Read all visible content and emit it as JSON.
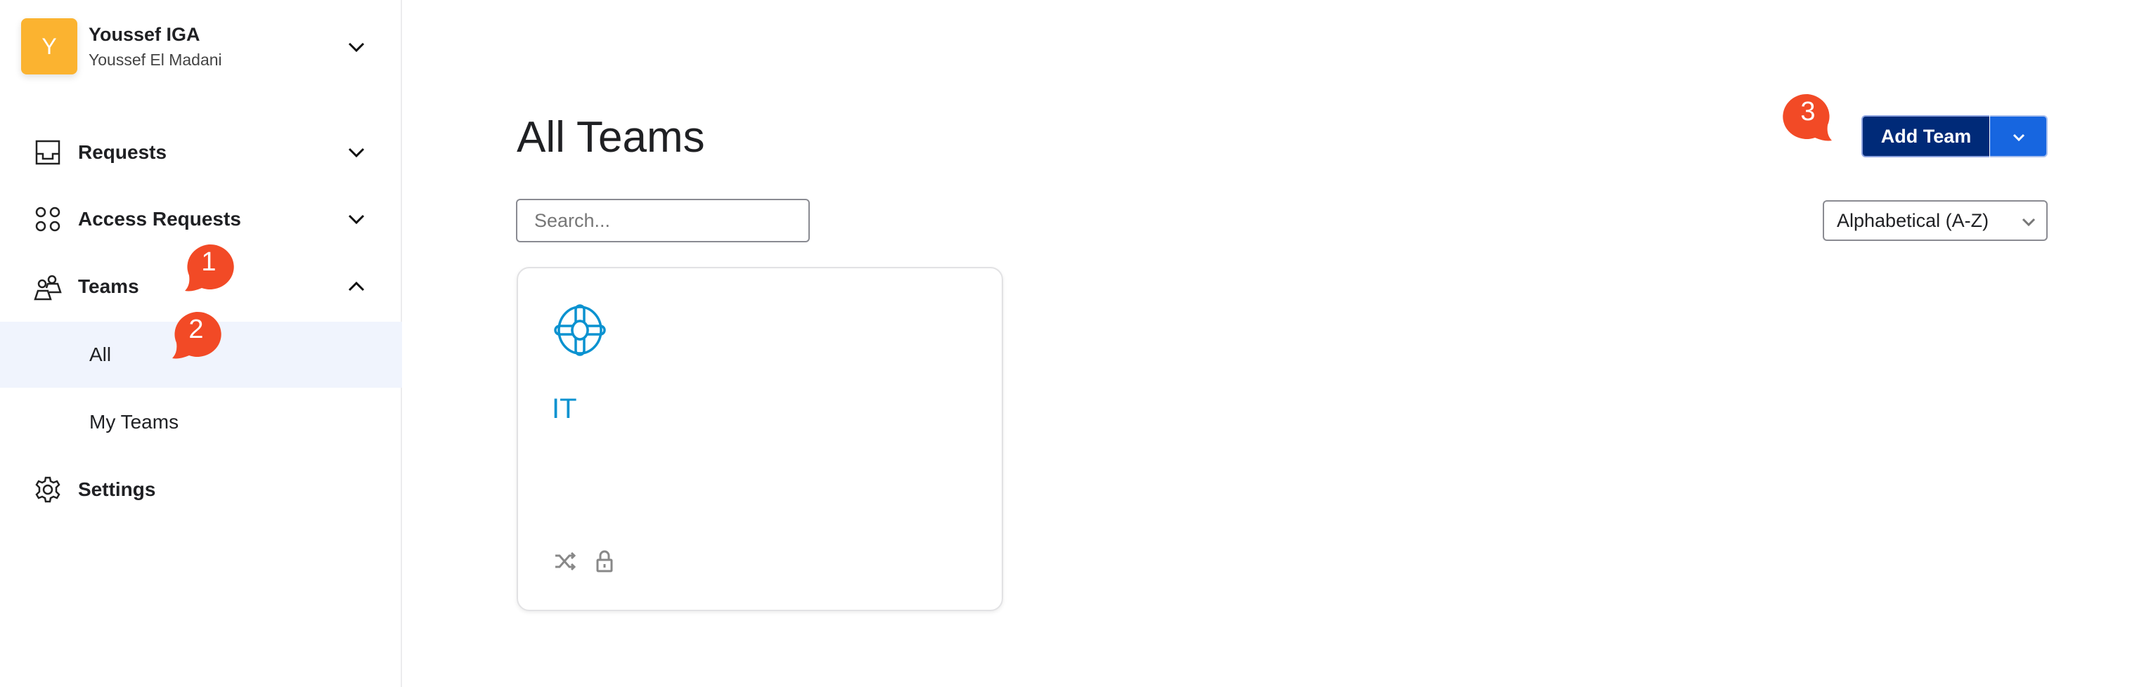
{
  "user": {
    "avatar_letter": "Y",
    "org": "Youssef IGA",
    "name": "Youssef El Madani"
  },
  "sidebar": {
    "items": [
      {
        "label": "Requests",
        "icon": "inbox-icon",
        "state": "collapsed"
      },
      {
        "label": "Access Requests",
        "icon": "grid-circles-icon",
        "state": "collapsed"
      },
      {
        "label": "Teams",
        "icon": "users-icon",
        "state": "expanded",
        "children": [
          {
            "label": "All",
            "active": true
          },
          {
            "label": "My Teams"
          }
        ]
      },
      {
        "label": "Settings",
        "icon": "gear-icon"
      }
    ]
  },
  "main": {
    "title": "All Teams",
    "search_placeholder": "Search...",
    "sort_value": "Alphabetical (A-Z)",
    "add_button": "Add Team",
    "teams": [
      {
        "name": "IT",
        "icon": "lifebuoy-icon",
        "badges": [
          "shuffle-icon",
          "lock-icon"
        ]
      }
    ]
  },
  "annotations": [
    "1",
    "2",
    "3"
  ],
  "colors": {
    "accent": "#002a78",
    "dropdown": "#1766e0",
    "team": "#0a92d0",
    "avatar": "#fbb330",
    "annotation": "#f24a26",
    "active_bg": "#f0f4fd"
  }
}
